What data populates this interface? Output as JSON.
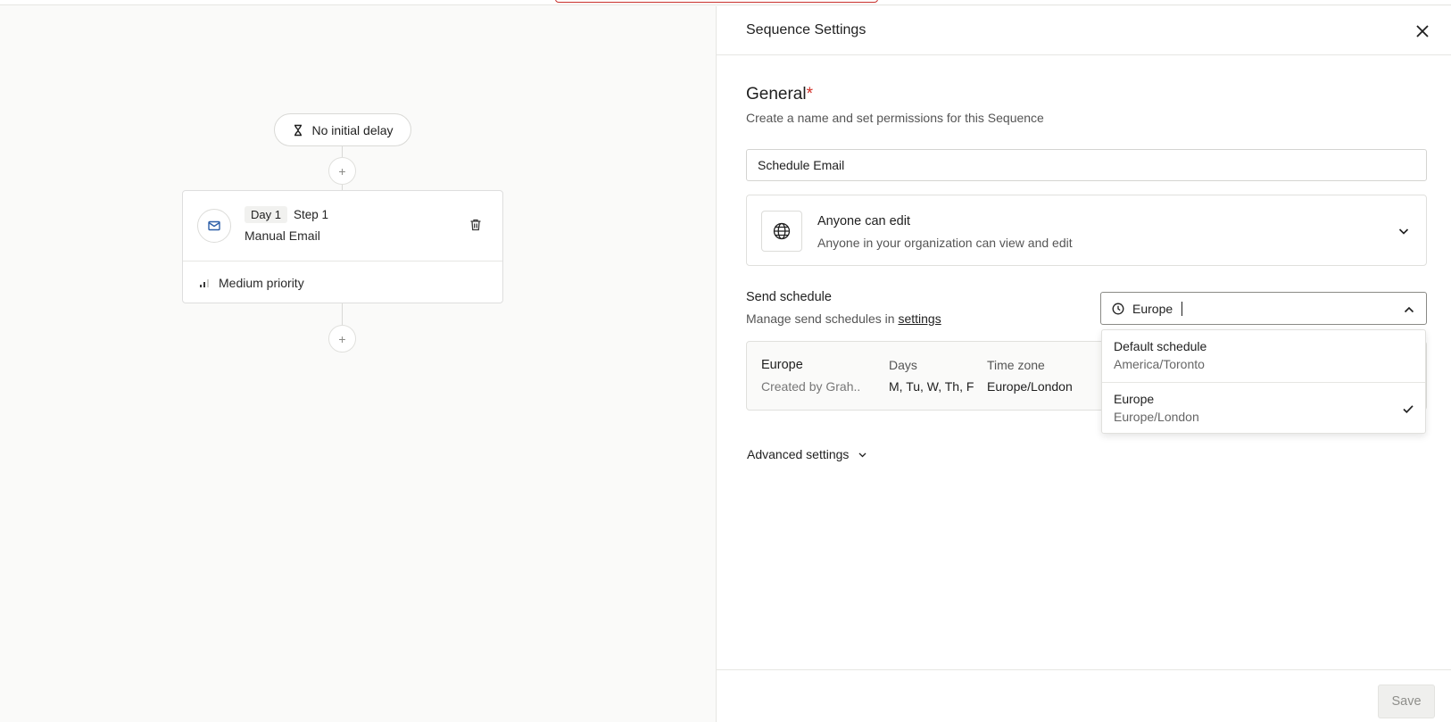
{
  "canvas": {
    "delay_label": "No initial delay",
    "add_symbol": "+",
    "step": {
      "day": "Day 1",
      "step": "Step 1",
      "type": "Manual Email",
      "priority": "Medium priority"
    }
  },
  "panel": {
    "title": "Sequence Settings",
    "general": {
      "title": "General",
      "required_mark": "*",
      "subtitle": "Create a name and set permissions for this Sequence",
      "name_value": "Schedule Email"
    },
    "permission": {
      "title": "Anyone can edit",
      "subtitle": "Anyone in your organization can view and edit"
    },
    "send_schedule": {
      "title": "Send schedule",
      "subtitle_prefix": "Manage send schedules in ",
      "settings_link": "settings",
      "search_value": "Europe",
      "card": {
        "name": "Europe",
        "creator": "Created by Grah...",
        "days_label": "Days",
        "days_value": "M, Tu, W, Th, F",
        "tz_label": "Time zone",
        "tz_value": "Europe/London"
      },
      "options": [
        {
          "title": "Default schedule",
          "sub": "America/Toronto",
          "selected": false
        },
        {
          "title": "Europe",
          "sub": "Europe/London",
          "selected": true
        }
      ]
    },
    "advanced_label": "Advanced settings",
    "save_label": "Save"
  },
  "colors": {
    "required": "#d22f27",
    "toast_border": "#c9302c",
    "canvas_bg": "#fafaf9"
  }
}
